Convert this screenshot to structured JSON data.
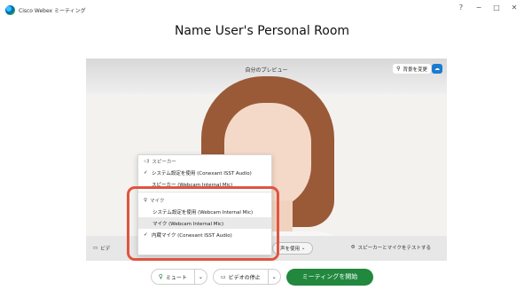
{
  "window": {
    "title": "Cisco Webex ミーティング",
    "controls": [
      "?",
      "−",
      "□",
      "✕"
    ]
  },
  "room_title": "Name User's Personal Room",
  "preview": {
    "label": "自分のプレビュー",
    "change_bg_label": "背景を変更"
  },
  "video_bar": {
    "video_label": "ビデ",
    "audio_button": "声を使用",
    "test_label": "スピーカーとマイクをテストする"
  },
  "menu": {
    "speaker_section": "スピーカー",
    "speaker_items": [
      {
        "label": "システム設定を使用 (Conexant ISST Audio)",
        "checked": true
      },
      {
        "label": "スピーカー (Webcam Internal Mic)",
        "checked": false
      }
    ],
    "mic_section": "マイク",
    "mic_items": [
      {
        "label": "システム設定を使用 (Webcam Internal Mic)",
        "checked": false
      },
      {
        "label": "マイク (Webcam Internal Mic)",
        "checked": false
      },
      {
        "label": "内蔵マイク (Conexant ISST Audio)",
        "checked": true
      }
    ]
  },
  "controls": {
    "mute_label": "ミュート",
    "stop_video_label": "ビデオの停止",
    "start_label": "ミーティングを開始"
  },
  "colors": {
    "start_button": "#21883e",
    "highlight": "#e0543f",
    "bg_button_accent": "#1a7bd1"
  }
}
